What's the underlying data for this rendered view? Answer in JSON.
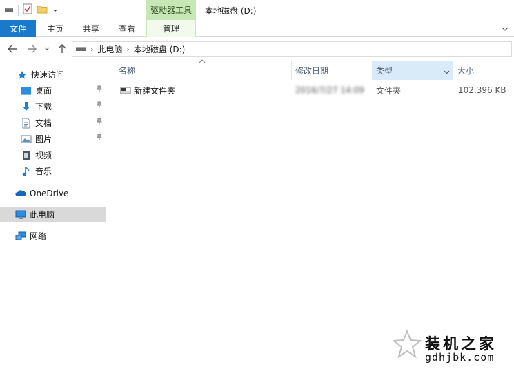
{
  "titlebar": {
    "context_group_label": "驱动器工具",
    "window_title": "本地磁盘 (D:)"
  },
  "ribbon": {
    "tabs": [
      "文件",
      "主页",
      "共享",
      "查看",
      "管理"
    ]
  },
  "address": {
    "breadcrumbs": [
      "此电脑",
      "本地磁盘 (D:)"
    ]
  },
  "sidebar": {
    "quick_access": "快速访问",
    "items": [
      {
        "label": "桌面",
        "icon": "desktop-icon",
        "pinned": true
      },
      {
        "label": "下载",
        "icon": "download-icon",
        "pinned": true
      },
      {
        "label": "文档",
        "icon": "documents-icon",
        "pinned": true
      },
      {
        "label": "图片",
        "icon": "pictures-icon",
        "pinned": true
      },
      {
        "label": "视频",
        "icon": "videos-icon",
        "pinned": false
      },
      {
        "label": "音乐",
        "icon": "music-icon",
        "pinned": false
      }
    ],
    "onedrive": "OneDrive",
    "this_pc": "此电脑",
    "network": "网络"
  },
  "columns": {
    "name": "名称",
    "date_modified": "修改日期",
    "type": "类型",
    "size": "大小"
  },
  "files": [
    {
      "name": "新建文件夹",
      "date_modified": "2016/7/27 14:09",
      "type": "文件夹",
      "size": "102,396 KB"
    }
  ],
  "watermark": {
    "brand": "装机之家",
    "url": "gdhjbk.com"
  },
  "colors": {
    "file_tab": "#1979ca",
    "context_tab": "#c7e8b5",
    "selected_nav": "#d9d9d9",
    "active_column": "#d9ebf9"
  }
}
